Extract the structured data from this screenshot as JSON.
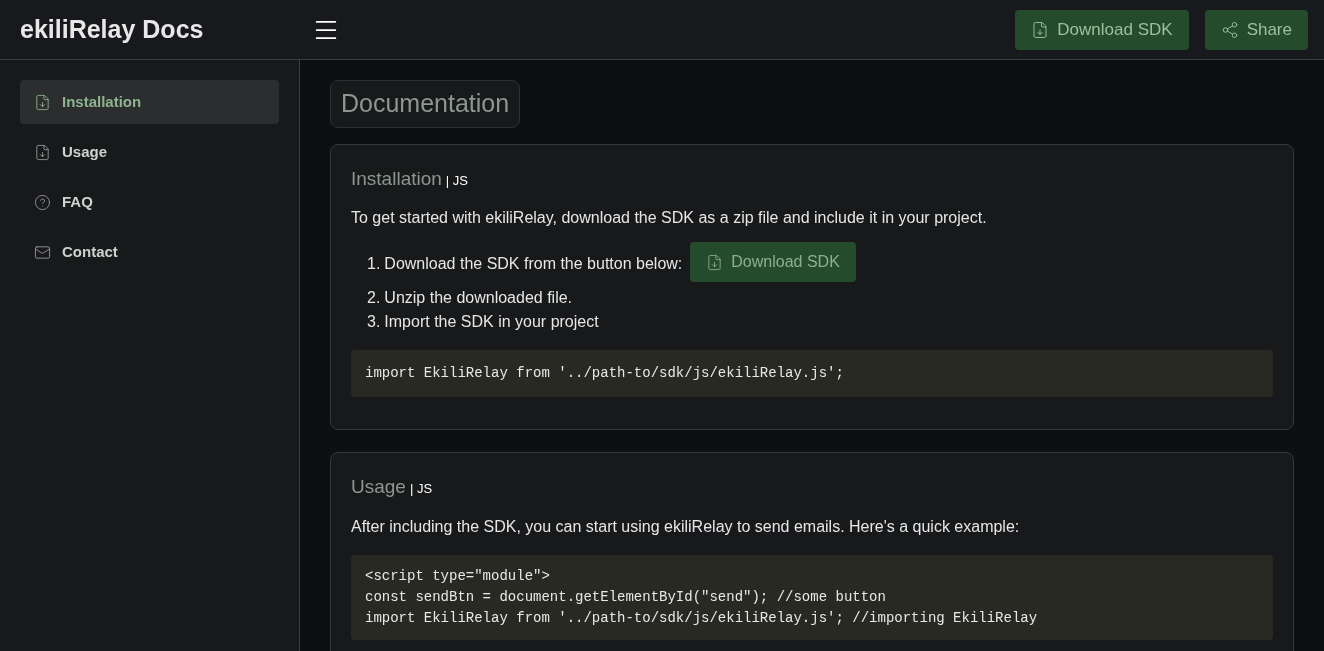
{
  "header": {
    "title": "ekiliRelay Docs",
    "buttons": [
      {
        "kind": "download",
        "label": "Download SDK"
      },
      {
        "kind": "share",
        "label": "Share"
      }
    ]
  },
  "sidebar": {
    "items": [
      {
        "kind": "download",
        "label": "Installation",
        "selected": true
      },
      {
        "kind": "download",
        "label": "Usage",
        "selected": false
      },
      {
        "kind": "help",
        "label": "FAQ",
        "selected": false
      },
      {
        "kind": "mail",
        "label": "Contact",
        "selected": false
      }
    ]
  },
  "page_title": "Documentation",
  "sections": [
    {
      "title": "Installation",
      "tag": "| JS",
      "intro": "To get started with ekiliRelay, download the SDK as a zip file and include it in your project.",
      "steps": [
        {
          "number": "1.",
          "text": "Download the SDK from the button below:",
          "button": "Download SDK"
        },
        {
          "number": "2.",
          "text": "Unzip the downloaded file."
        },
        {
          "number": "3.",
          "text": "Import the SDK in your project"
        }
      ],
      "code": [
        "import EkiliRelay from '../path-to/sdk/js/ekiliRelay.js';"
      ]
    },
    {
      "title": "Usage",
      "tag": "| JS",
      "intro": "After including the SDK, you can start using ekiliRelay to send emails. Here's a quick example:",
      "code": [
        "<script type=\"module\">",
        "const sendBtn = document.getElementById(\"send\"); //some button",
        "import EkiliRelay from '../path-to/sdk/js/ekiliRelay.js'; //importing EkiliRelay"
      ]
    }
  ]
}
